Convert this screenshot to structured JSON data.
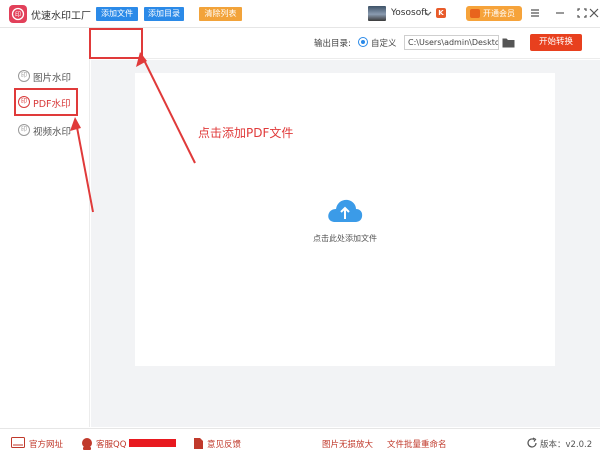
{
  "window": {
    "title": "优速水印工厂",
    "username": "Yososoft",
    "vip_label": "开通会员",
    "k_badge": "K"
  },
  "sidebar": {
    "items": [
      {
        "label": "图片水印",
        "icon": "印"
      },
      {
        "label": "PDF水印",
        "icon": "印"
      },
      {
        "label": "视频水印",
        "icon": "印"
      }
    ]
  },
  "toolbar": {
    "add_file": "添加文件",
    "add_folder": "添加目录",
    "clear_list": "清除列表",
    "output_label": "输出目录:",
    "radio_label": "自定义",
    "output_path": "C:\\Users\\admin\\Deskto",
    "start_label": "开始转换"
  },
  "main": {
    "drop_hint": "点击此处添加文件",
    "annotation": "点击添加PDF文件"
  },
  "footer": {
    "website": "官方网址",
    "qq": "客服QQ",
    "feedback": "意见反馈",
    "lossless": "图片无损放大",
    "rename": "文件批量重命名",
    "version": "版本：v2.0.2"
  },
  "colors": {
    "accent_blue": "#2b8ae8",
    "accent_red": "#e03a3a",
    "start_orange": "#e8401e",
    "clear_orange": "#f2a33a"
  }
}
